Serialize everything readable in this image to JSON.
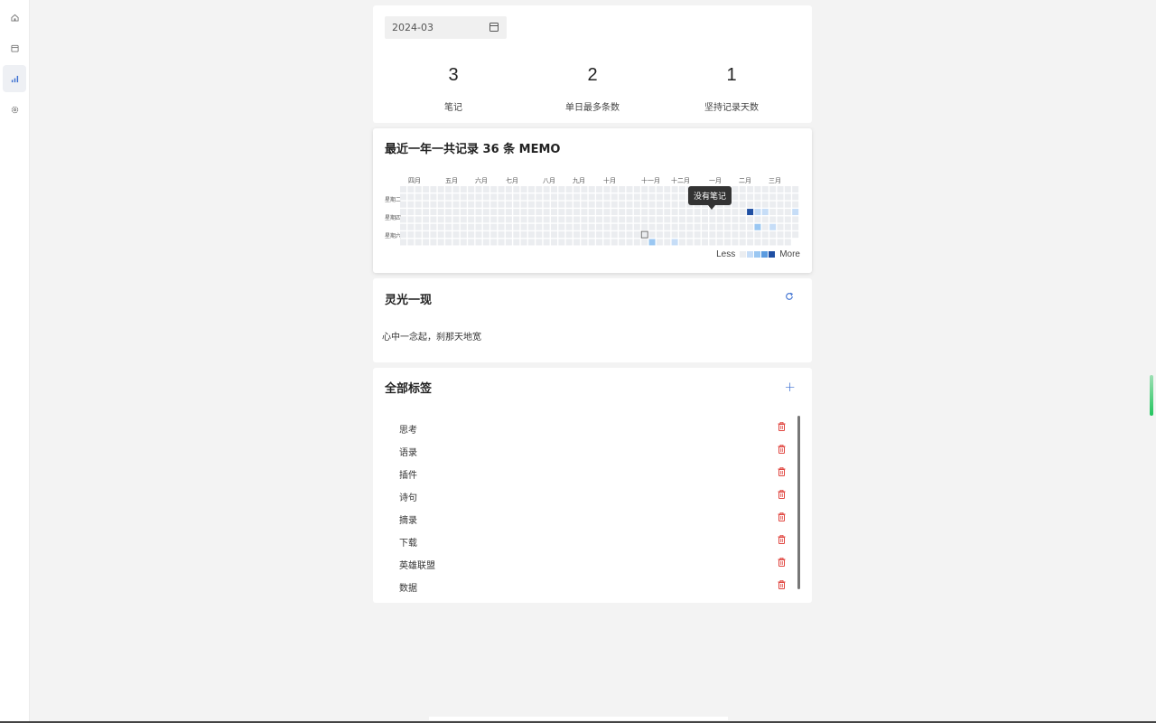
{
  "sidebar": {
    "items": [
      {
        "icon": "home-icon",
        "active": false
      },
      {
        "icon": "calendar-icon",
        "active": false
      },
      {
        "icon": "bar-chart-icon",
        "active": true
      },
      {
        "icon": "gear-icon",
        "active": false
      }
    ]
  },
  "filter": {
    "date": "2024-03"
  },
  "stats": [
    {
      "value": "3",
      "label": "笔记"
    },
    {
      "value": "2",
      "label": "单日最多条数"
    },
    {
      "value": "1",
      "label": "坚持记录天数"
    }
  ],
  "heatmap": {
    "title": "最近一年一共记录 36 条 MEMO",
    "months": [
      "四月",
      "五月",
      "六月",
      "七月",
      "八月",
      "九月",
      "十月",
      "十一月",
      "十二月",
      "一月",
      "二月",
      "三月"
    ],
    "day_labels": [
      "星期二",
      "星期四",
      "星期六"
    ],
    "tooltip": "没有笔记",
    "legend_less": "Less",
    "legend_more": "More",
    "colors": [
      "#ebedf0",
      "#c6ddf7",
      "#9ac7f2",
      "#5a9be0",
      "#1f4fa3"
    ]
  },
  "inspiration": {
    "title": "灵光一现",
    "text": "心中一念起，刹那天地宽"
  },
  "tags": {
    "title": "全部标签",
    "items": [
      "思考",
      "语录",
      "插件",
      "诗句",
      "摘录",
      "下载",
      "英雄联盟",
      "数据"
    ]
  },
  "colors": {
    "accent": "#3b6fd1",
    "delete": "#e0443e"
  }
}
